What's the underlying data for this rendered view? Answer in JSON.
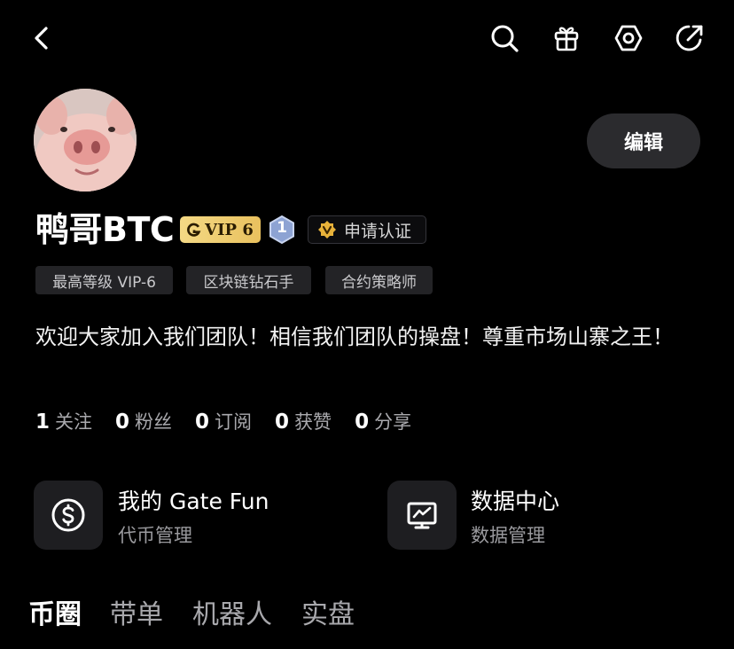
{
  "topbar": {
    "icons": [
      "back-icon",
      "search-icon",
      "gift-icon",
      "settings-icon",
      "share-icon"
    ]
  },
  "profile": {
    "username": "鸭哥BTC",
    "vip_label": "VIP 6",
    "level_number": "1",
    "verify_label": "申请认证",
    "edit_label": "编辑",
    "tags": [
      "最高等级 VIP-6",
      "区块链钻石手",
      "合约策略师"
    ],
    "bio": "欢迎大家加入我们团队！相信我们团队的操盘！尊重市场山寨之王！"
  },
  "stats": [
    {
      "value": "1",
      "label": "关注"
    },
    {
      "value": "0",
      "label": "粉丝"
    },
    {
      "value": "0",
      "label": "订阅"
    },
    {
      "value": "0",
      "label": "获赞"
    },
    {
      "value": "0",
      "label": "分享"
    }
  ],
  "cards": [
    {
      "title": "我的 Gate Fun",
      "subtitle": "代币管理",
      "icon": "dollar-circle-icon"
    },
    {
      "title": "数据中心",
      "subtitle": "数据管理",
      "icon": "monitor-chart-icon"
    }
  ],
  "tabs": [
    "币圈",
    "带单",
    "机器人",
    "实盘"
  ],
  "colors": {
    "background": "#000000",
    "vip_gold": "#f1cf72",
    "level_badge": "#9fb3dc",
    "verify_gold": "#e8b23a"
  }
}
